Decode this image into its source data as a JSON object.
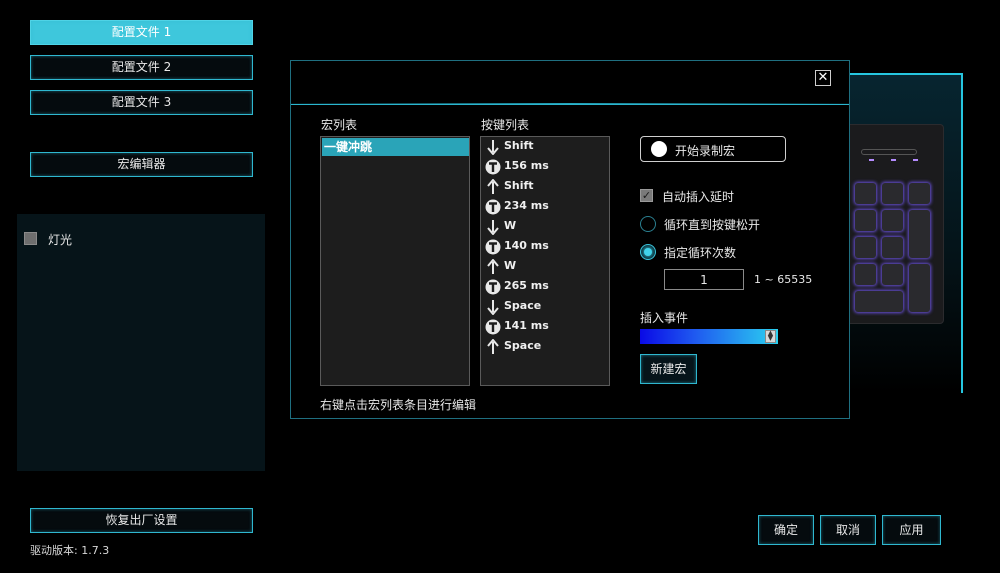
{
  "sidebar": {
    "profiles": [
      {
        "label": "配置文件 1",
        "active": true
      },
      {
        "label": "配置文件 2",
        "active": false
      },
      {
        "label": "配置文件 3",
        "active": false
      }
    ],
    "macro_editor_label": "宏编辑器",
    "lighting_label": "灯光",
    "reset_label": "恢复出厂设置",
    "driver_version": "驱动版本: 1.7.3"
  },
  "dialog": {
    "macro_list_title": "宏列表",
    "key_list_title": "按键列表",
    "macro_items": [
      "一键冲跳"
    ],
    "key_events": [
      {
        "type": "down",
        "text": "Shift"
      },
      {
        "type": "delay",
        "text": "156 ms"
      },
      {
        "type": "up",
        "text": "Shift"
      },
      {
        "type": "delay",
        "text": "234 ms"
      },
      {
        "type": "down",
        "text": "W"
      },
      {
        "type": "delay",
        "text": "140 ms"
      },
      {
        "type": "up",
        "text": "W"
      },
      {
        "type": "delay",
        "text": "265 ms"
      },
      {
        "type": "down",
        "text": "Space"
      },
      {
        "type": "delay",
        "text": "141 ms"
      },
      {
        "type": "up",
        "text": "Space"
      }
    ],
    "record_label": "开始录制宏",
    "auto_delay_label": "自动插入延时",
    "auto_delay_checked": true,
    "loop_until_release_label": "循环直到按键松开",
    "loop_count_label": "指定循环次数",
    "loop_mode": "count",
    "loop_count_value": "1",
    "loop_range": "1 ~ 65535",
    "insert_event_label": "插入事件",
    "new_macro_label": "新建宏",
    "hint": "右键点击宏列表条目进行编辑",
    "close_symbol": "✕"
  },
  "footer": {
    "ok_label": "确定",
    "cancel_label": "取消",
    "apply_label": "应用"
  },
  "colors": {
    "accent": "#2fb7cf",
    "active_profile": "#3ec7dc",
    "selected_item": "#2aa4b8"
  }
}
